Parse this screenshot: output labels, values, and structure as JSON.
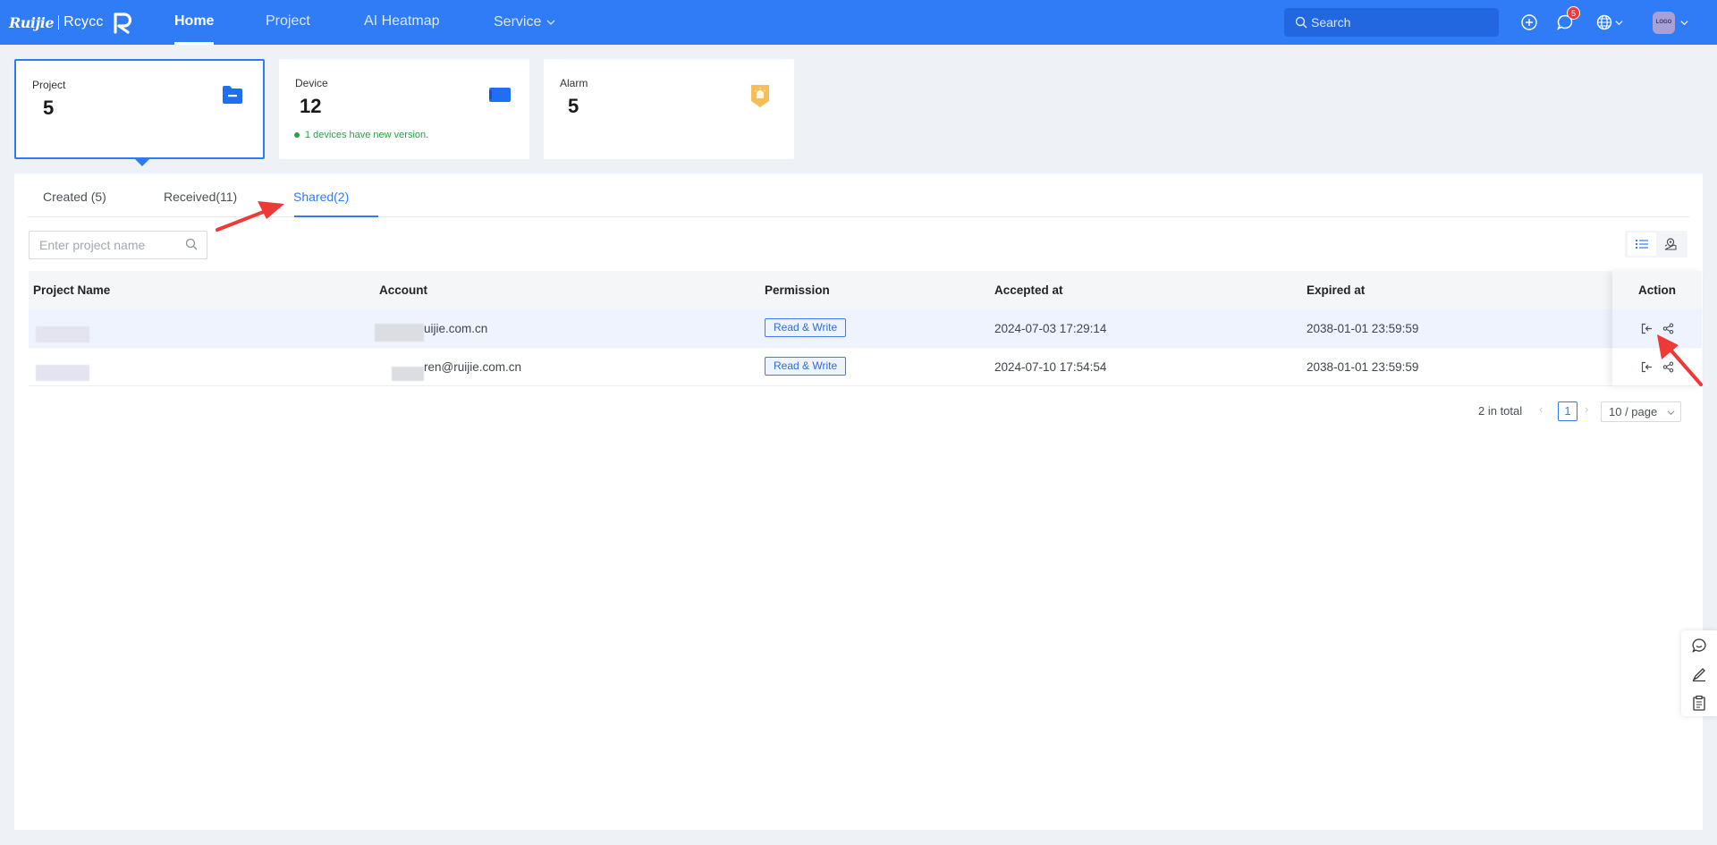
{
  "header": {
    "logo_brand": "Ruijie",
    "logo_product": "Rcycc",
    "nav": [
      {
        "label": "Home"
      },
      {
        "label": "Project"
      },
      {
        "label": "AI Heatmap"
      },
      {
        "label": "Service"
      }
    ],
    "search_placeholder": "Search",
    "message_badge": "5",
    "avatar_text": "LOGO"
  },
  "cards": [
    {
      "label": "Project",
      "value": "5"
    },
    {
      "label": "Device",
      "value": "12",
      "note": "1 devices have new version."
    },
    {
      "label": "Alarm",
      "value": "5"
    }
  ],
  "tabs": [
    {
      "label": "Created (5)"
    },
    {
      "label": "Received(11)"
    },
    {
      "label": "Shared(2)"
    }
  ],
  "filter": {
    "placeholder": "Enter project name"
  },
  "table": {
    "columns": [
      "Project Name",
      "Account",
      "Permission",
      "Accepted at",
      "Expired at",
      "Action"
    ],
    "rows": [
      {
        "account": "uijie.com.cn",
        "permission": "Read & Write",
        "accepted": "2024-07-03 17:29:14",
        "expired": "2038-01-01 23:59:59"
      },
      {
        "account": "ren@ruijie.com.cn",
        "permission": "Read & Write",
        "accepted": "2024-07-10 17:54:54",
        "expired": "2038-01-01 23:59:59"
      }
    ]
  },
  "pagination": {
    "total": "2 in total",
    "current_page": "1",
    "page_size": "10 / page"
  },
  "colors": {
    "primary": "#2f7cf6",
    "success": "#2ea043",
    "annotation": "#ee3a37",
    "alarm": "#f7b23b"
  }
}
